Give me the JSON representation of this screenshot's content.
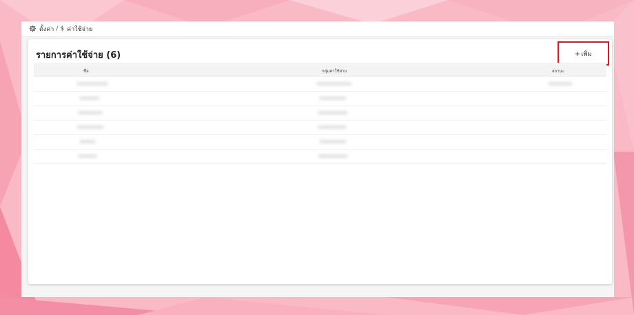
{
  "breadcrumb": {
    "settings_label": "ตั้งค่า",
    "separator": "/",
    "currency_symbol": "$",
    "current_label": "ค่าใช้จ่าย"
  },
  "card": {
    "title": "รายการค่าใช้จ่าย (6)",
    "add_button_label": "เพิ่ม"
  },
  "table": {
    "columns": [
      "ชื่อ",
      "กลุ่มค่าใช้จ่าย",
      "สถานะ"
    ],
    "row_count": 6
  },
  "colors": {
    "background": "#f9b6c3",
    "highlight_border": "#e2141f",
    "card": "#ffffff"
  }
}
